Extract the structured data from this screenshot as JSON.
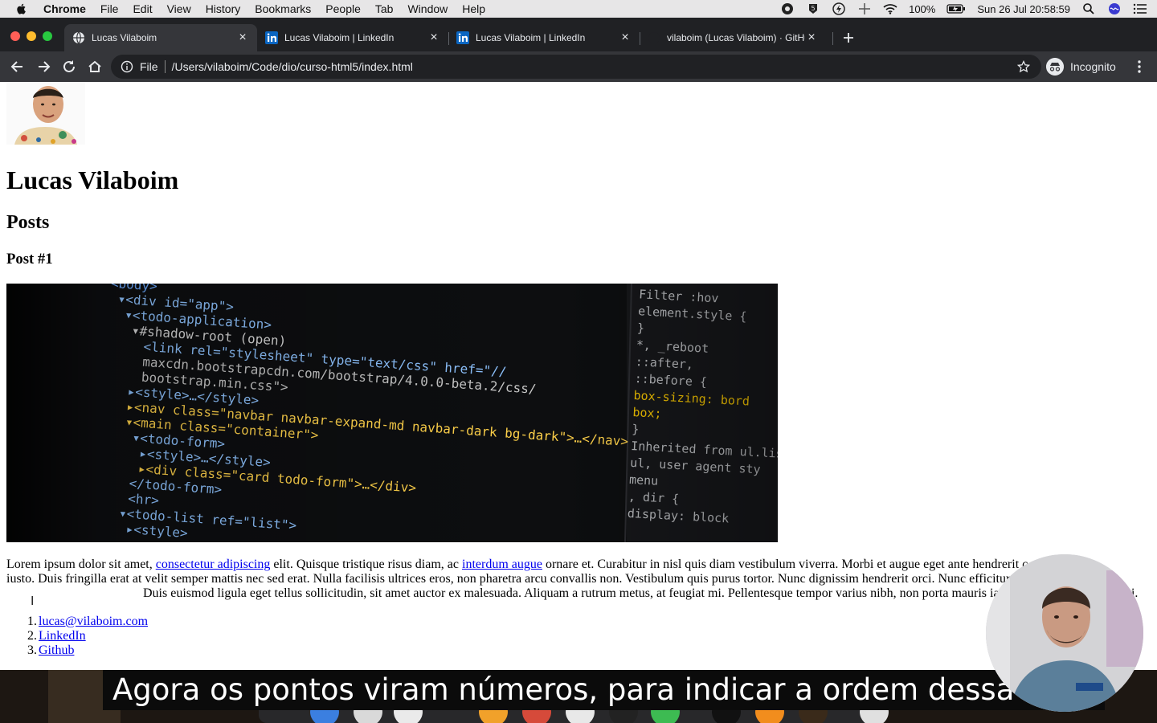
{
  "menubar": {
    "app_name": "Chrome",
    "items": [
      "File",
      "Edit",
      "View",
      "History",
      "Bookmarks",
      "People",
      "Tab",
      "Window",
      "Help"
    ],
    "battery": "100%",
    "clock": "Sun 26 Jul  20:58:59"
  },
  "tabs": [
    {
      "title": "Lucas Vilaboim",
      "icon": "globe-icon",
      "active": true
    },
    {
      "title": "Lucas Vilaboim | LinkedIn",
      "icon": "linkedin-icon",
      "active": false
    },
    {
      "title": "Lucas Vilaboim | LinkedIn",
      "icon": "linkedin-icon",
      "active": false
    },
    {
      "title": "vilaboim (Lucas Vilaboim) · GitHub",
      "icon": "github-icon",
      "active": false
    }
  ],
  "toolbar": {
    "scheme_label": "File",
    "url": "/Users/vilaboim/Code/dio/curso-html5/index.html",
    "profile_label": "Incognito"
  },
  "page": {
    "name": "Lucas Vilaboim",
    "section": "Posts",
    "post_title": "Post #1",
    "paragraph": {
      "p1": "Lorem ipsum dolor sit amet, ",
      "link1": "consectetur adipiscing",
      "p2": " elit. Quisque tristique risus diam, ac ",
      "link2": "interdum augue",
      "p3": " ornare et. Curabitur in nisl quis diam vestibulum viverra. Morbi et augue eget ante hendrerit c",
      "p4": "iusto. Duis fringilla erat at velit semper mattis nec sed erat. Nulla facilisis ultrices eros, non pharetra arcu convallis non. Vestibulum quis purus tortor. Nunc dignissim hendrerit orci. Nunc efficitur liber",
      "p5": "Duis euismod ligula eget tellus sollicitudin, sit amet auctor ex malesuada. Aliquam a rutrum metus, at feugiat mi. Pellentesque tempor varius nibh, non porta mauris iaculis aliquet. Nulla facilisi."
    },
    "links": [
      {
        "num": "1.",
        "label": "lucas@vilaboim.com"
      },
      {
        "num": "2.",
        "label": "LinkedIn"
      },
      {
        "num": "3.",
        "label": "Github"
      }
    ],
    "code_lines": [
      {
        "text": "<body>"
      },
      {
        "text": "▾<div id=\"app\">"
      },
      {
        "text": "▾<todo-application>"
      },
      {
        "text": "▾#shadow-root (open)"
      },
      {
        "text": "<link rel=\"stylesheet\" type=\"text/css\" href=\"//"
      },
      {
        "text": "maxcdn.bootstrapcdn.com/bootstrap/4.0.0-beta.2/css/"
      },
      {
        "text": "bootstrap.min.css\">"
      },
      {
        "text": "▸<style>…</style>"
      },
      {
        "text": "▸<nav class=\"navbar navbar-expand-md navbar-dark bg-dark\">…</nav>"
      },
      {
        "text": "▾<main class=\"container\">"
      },
      {
        "text": "▾<todo-form>"
      },
      {
        "text": "▸<style>…</style>"
      },
      {
        "text": "▸<div class=\"card todo-form\">…</div>"
      },
      {
        "text": "</todo-form>"
      },
      {
        "text": "<hr>"
      },
      {
        "text": "▾<todo-list ref=\"list\">"
      },
      {
        "text": "▸<style>"
      }
    ],
    "styles_panel": [
      {
        "text": "Filter                :hov"
      },
      {
        "text": "element.style {"
      },
      {
        "text": "}"
      },
      {
        "text": "*,               _reboot"
      },
      {
        "text": "::after,"
      },
      {
        "text": "::before {"
      },
      {
        "text": "  box-sizing: bord"
      },
      {
        "text": "       box;"
      },
      {
        "text": "}"
      },
      {
        "text": "Inherited from ul.list"
      },
      {
        "text": "ul,  user agent sty"
      },
      {
        "text": "menu"
      },
      {
        "text": ", dir {"
      },
      {
        "text": "   display: block"
      }
    ]
  },
  "subtitle": "Agora os pontos viram números, para indicar a ordem dessa lista.",
  "colors": {
    "link": "#0000ee",
    "tab_bg": "#202124",
    "toolbar_bg": "#35363a",
    "code_tag": "#5ab0ff",
    "code_attr": "#f3c300",
    "code_value": "#ffd24a"
  }
}
